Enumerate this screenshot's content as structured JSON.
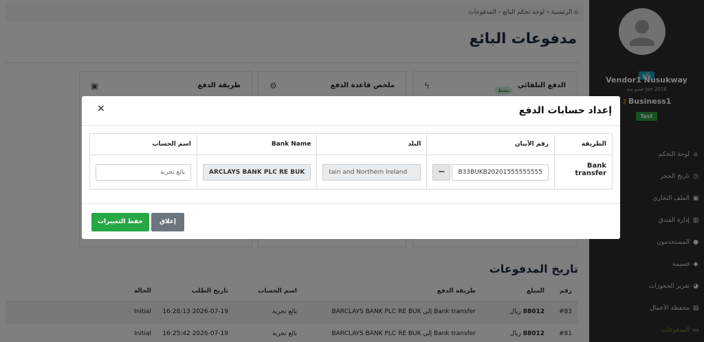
{
  "sidebar": {
    "role_badge": "بائع",
    "vendor_name": "Vendor1 Nusukway",
    "member_since": "عضو منذ Jan 2026",
    "business_name": "Business1",
    "business_badge": "Test",
    "items": [
      {
        "label": "لوحة التحكم",
        "icon": "home-icon",
        "glyph": "⌂"
      },
      {
        "label": "تاريخ الحجز",
        "icon": "clock-icon",
        "glyph": "◷"
      },
      {
        "label": "الملف التجاري",
        "icon": "briefcase-icon",
        "glyph": "▣"
      },
      {
        "label": "إدارة الفندق",
        "icon": "building-icon",
        "glyph": "▥"
      },
      {
        "label": "المستخدمون",
        "icon": "users-icon",
        "glyph": "●"
      },
      {
        "label": "قسيمة",
        "icon": "tag-icon",
        "glyph": "◆"
      },
      {
        "label": "تقرير الحجوزات",
        "icon": "chart-pie-icon",
        "glyph": "◕"
      },
      {
        "label": "محفظة الأعمال",
        "icon": "wallet-icon",
        "glyph": "▤"
      },
      {
        "label": "المدفوعات",
        "icon": "credit-card-icon",
        "glyph": "▭"
      }
    ]
  },
  "breadcrumb": "الرئيسية ‹ لوحة تحكم البائع ‹ المدفوعات",
  "page_title": "مدفوعات البائع",
  "cards": {
    "auto_payment": {
      "title": "الدفع التلقائي",
      "status": "نشط"
    },
    "payment_rule": {
      "title": "ملخص قاعدة الدفع"
    },
    "payment_method": {
      "title": "طريقة الدفع"
    }
  },
  "history": {
    "title": "تاريخ المدفوعات",
    "columns": [
      "رقم",
      "المبلغ",
      "طريقة الدفع",
      "اسم الحساب",
      "تاريخ الطلب",
      "الحالة"
    ],
    "rows": [
      {
        "id": "#83",
        "amount": "88012",
        "currency": "ريال",
        "method": "Bank transfer إلى BARCLAYS BANK PLC RE BUK",
        "account": "بائع تجربة",
        "date": "2026-07-19 16:28:13",
        "status": "Initial"
      },
      {
        "id": "#81",
        "amount": "88012",
        "currency": "ريال",
        "method": "Bank transfer إلى BARCLAYS BANK PLC RE BUK",
        "account": "بائع تجربة",
        "date": "2026-07-19 16:25:42",
        "status": "Initial"
      }
    ]
  },
  "modal": {
    "title": "إعداد حسابات الدفع",
    "close_glyph": "×",
    "columns": {
      "method": "الطريقة",
      "iban": "رقم الآيبان",
      "country": "البلد",
      "bank_name": "Bank Name",
      "account_name": "اسم الحساب"
    },
    "row": {
      "method": "Bank transfer",
      "iban_button": "−",
      "iban": "B33BUKB20201555555555",
      "country": "tain and Northern Ireland",
      "bank_name": "ARCLAYS BANK PLC RE BUK",
      "account_name": "بائع تجربة"
    },
    "save_label": "حفظ التغييرات",
    "close_label": "إغلاق"
  }
}
